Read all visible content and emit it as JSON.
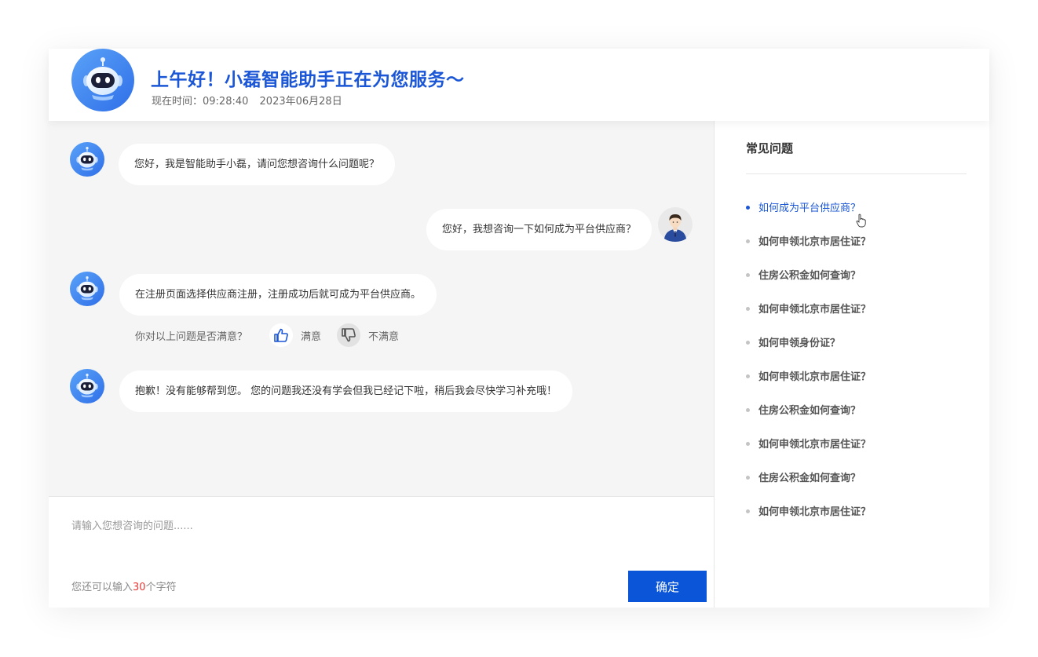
{
  "header": {
    "title": "上午好！小磊智能助手正在为您服务～",
    "time_label": "现在时间：09:28:40",
    "date": "2023年06月28日"
  },
  "chat": {
    "messages": [
      {
        "from": "bot",
        "text": "您好，我是智能助手小磊，请问您想咨询什么问题呢？"
      },
      {
        "from": "user",
        "text": "您好，我想咨询一下如何成为平台供应商？"
      },
      {
        "from": "bot",
        "text": "在注册页面选择供应商注册，注册成功后就可成为平台供应商。"
      },
      {
        "from": "bot",
        "text": "抱歉！没有能够帮到您。 您的问题我还没有学会但我已经记下啦，稍后我会尽快学习补充哦！"
      }
    ],
    "feedback": {
      "question": "你对以上问题是否满意？",
      "satisfied": "满意",
      "unsatisfied": "不满意"
    }
  },
  "input": {
    "placeholder": "请输入您想咨询的问题......",
    "remaining_prefix": "您还可以输入",
    "remaining_count": "30",
    "remaining_suffix": "个字符",
    "submit_label": "确定"
  },
  "faq": {
    "title": "常见问题",
    "items": [
      "如何成为平台供应商？",
      "如何申领北京市居住证？",
      "住房公积金如何查询？",
      "如何申领北京市居住证？",
      "如何申领身份证？",
      "如何申领北京市居住证？",
      "住房公积金如何查询？",
      "如何申领北京市居住证？",
      "住房公积金如何查询？",
      "如何申领北京市居住证？"
    ]
  },
  "colors": {
    "accent": "#1a56d6",
    "button": "#0a55d8",
    "count": "#e53935"
  }
}
